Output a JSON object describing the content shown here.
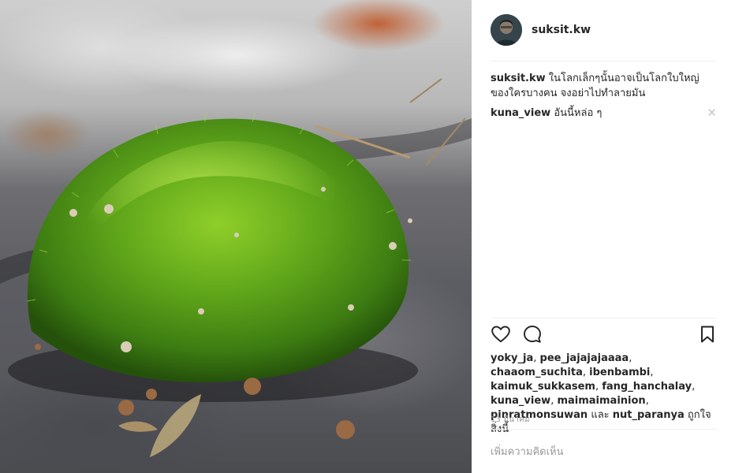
{
  "post": {
    "image_alt": "moss on rock",
    "header": {
      "username": "suksit.kw"
    },
    "caption": {
      "username": "suksit.kw",
      "text": "ในโลกเล็กๆนั้นอาจเป็นโลกใบใหญ่ของใครบางคน จงอย่าไปทำลายมัน"
    },
    "comments": [
      {
        "username": "kuna_view",
        "text": "อันนี้หล่อ ๆ"
      }
    ],
    "actions": {
      "like_icon": "heart-icon",
      "comment_icon": "comment-icon",
      "save_icon": "bookmark-icon"
    },
    "likes": {
      "users": [
        "yoky_ja",
        "pee_jajajajaaaa",
        "chaaom_suchita",
        "ibenbambi",
        "kaimuk_sukkasem",
        "fang_hanchalay",
        "kuna_view",
        "maimaimainion",
        "pinratmonsuwan",
        "nut_paranya"
      ],
      "separator": ",",
      "and_word": "และ",
      "suffix": "ถูกใจสิ่งนี้"
    },
    "date": "13 มีนาคม",
    "add_comment_placeholder": "เพิ่มความคิดเห็น"
  }
}
